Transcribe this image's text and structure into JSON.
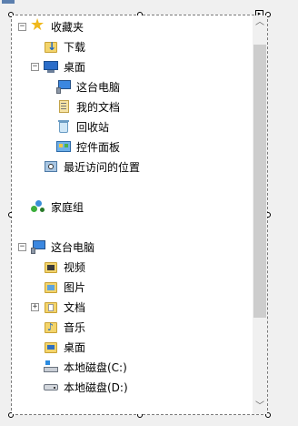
{
  "tree": {
    "favorites": {
      "label": "收藏夹",
      "expand": "−",
      "icon": "star-icon",
      "items": [
        {
          "label": "下载",
          "icon": "downloads-folder-icon"
        },
        {
          "label": "桌面",
          "icon": "desktop-icon",
          "expand": "−",
          "children": [
            {
              "label": "这台电脑",
              "icon": "this-pc-icon"
            },
            {
              "label": "我的文档",
              "icon": "documents-icon"
            },
            {
              "label": "回收站",
              "icon": "recycle-bin-icon"
            },
            {
              "label": "控件面板",
              "icon": "control-panel-icon"
            }
          ]
        },
        {
          "label": "最近访问的位置",
          "icon": "recent-places-icon"
        }
      ]
    },
    "homegroup": {
      "label": "家庭组",
      "icon": "homegroup-icon"
    },
    "this_pc": {
      "label": "这台电脑",
      "expand": "−",
      "icon": "this-pc-icon",
      "items": [
        {
          "label": "视频",
          "icon": "videos-folder-icon"
        },
        {
          "label": "图片",
          "icon": "pictures-folder-icon"
        },
        {
          "label": "文档",
          "icon": "documents-folder-icon",
          "expand": "+"
        },
        {
          "label": "音乐",
          "icon": "music-folder-icon"
        },
        {
          "label": "桌面",
          "icon": "desktop-folder-icon"
        },
        {
          "label": "本地磁盘(C:)",
          "icon": "local-disk-c-icon"
        },
        {
          "label": "本地磁盘(D:)",
          "icon": "local-disk-d-icon"
        }
      ]
    }
  },
  "scrollbar": {
    "up_glyph": "︿",
    "down_glyph": "﹀"
  },
  "smart_tag_glyph": "▸",
  "colors": {
    "tree_bg": "#ffffff",
    "window_bg": "#f0f0f0",
    "folder": "#f3d46b",
    "scroll_thumb": "#cdcdcd"
  }
}
